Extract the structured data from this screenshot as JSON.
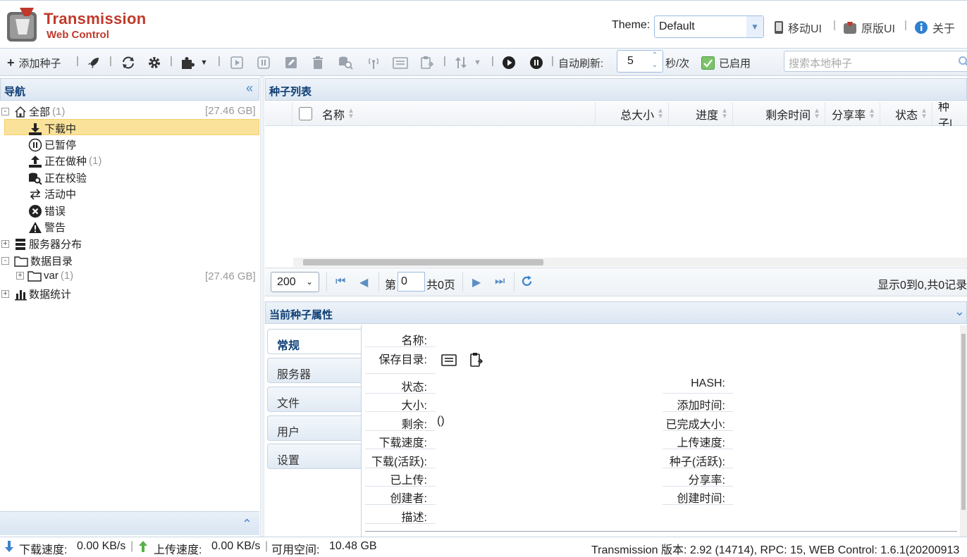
{
  "header": {
    "logo_line1": "Transmission",
    "logo_line2": "Web Control",
    "theme_label": "Theme:",
    "theme_value": "Default",
    "mobile_ui": "移动UI",
    "original_ui": "原版UI",
    "about": "关于"
  },
  "toolbar": {
    "add_torrent": "添加种子",
    "auto_refresh_label": "自动刷新:",
    "refresh_interval": "5",
    "refresh_unit": "秒/次",
    "enabled_label": "已启用",
    "search_placeholder": "搜索本地种子"
  },
  "nav": {
    "title": "导航",
    "all": {
      "label": "全部",
      "count": "(1)",
      "size": "[27.46 GB]"
    },
    "downloading": "下载中",
    "paused": "已暂停",
    "seeding": {
      "label": "正在做种",
      "count": "(1)"
    },
    "checking": "正在校验",
    "active": "活动中",
    "error": "错误",
    "warning": "警告",
    "servers": "服务器分布",
    "dirs": "数据目录",
    "var": {
      "label": "var",
      "count": "(1)",
      "size": "[27.46 GB]"
    },
    "stats": "数据统计"
  },
  "list": {
    "title": "种子列表",
    "columns": [
      "名称",
      "总大小",
      "进度",
      "剩余时间",
      "分享率",
      "状态",
      "种子|"
    ],
    "page_size": "200",
    "page_prefix": "第",
    "page_value": "0",
    "page_total": "共0页",
    "record_info": "显示0到0,共0记录"
  },
  "props": {
    "title": "当前种子属性",
    "tabs": [
      "常规",
      "服务器",
      "文件",
      "用户",
      "设置"
    ],
    "name": "名称:",
    "save_dir": "保存目录:",
    "status": "状态:",
    "hash": "HASH:",
    "size": "大小:",
    "added": "添加时间:",
    "remaining": "剩余:",
    "remaining_value": "()",
    "completed": "已完成大小:",
    "dl_speed": "下载速度:",
    "ul_speed": "上传速度:",
    "dl_active": "下载(活跃):",
    "seed_active": "种子(活跃):",
    "uploaded": "已上传:",
    "ratio": "分享率:",
    "creator": "创建者:",
    "created": "创建时间:",
    "comment": "描述:"
  },
  "status": {
    "dl_label": "下载速度:",
    "dl_value": "0.00 KB/s",
    "ul_label": "上传速度:",
    "ul_value": "0.00 KB/s",
    "free_label": "可用空间:",
    "free_value": "10.48 GB",
    "version": "Transmission 版本: 2.92 (14714), RPC: 15, WEB Control: 1.6.1(20200913"
  },
  "colors": {
    "accent": "#4c86c6",
    "title_blue": "#0e3e74",
    "brand_red": "#c0392b",
    "selection": "#fbe29a"
  }
}
